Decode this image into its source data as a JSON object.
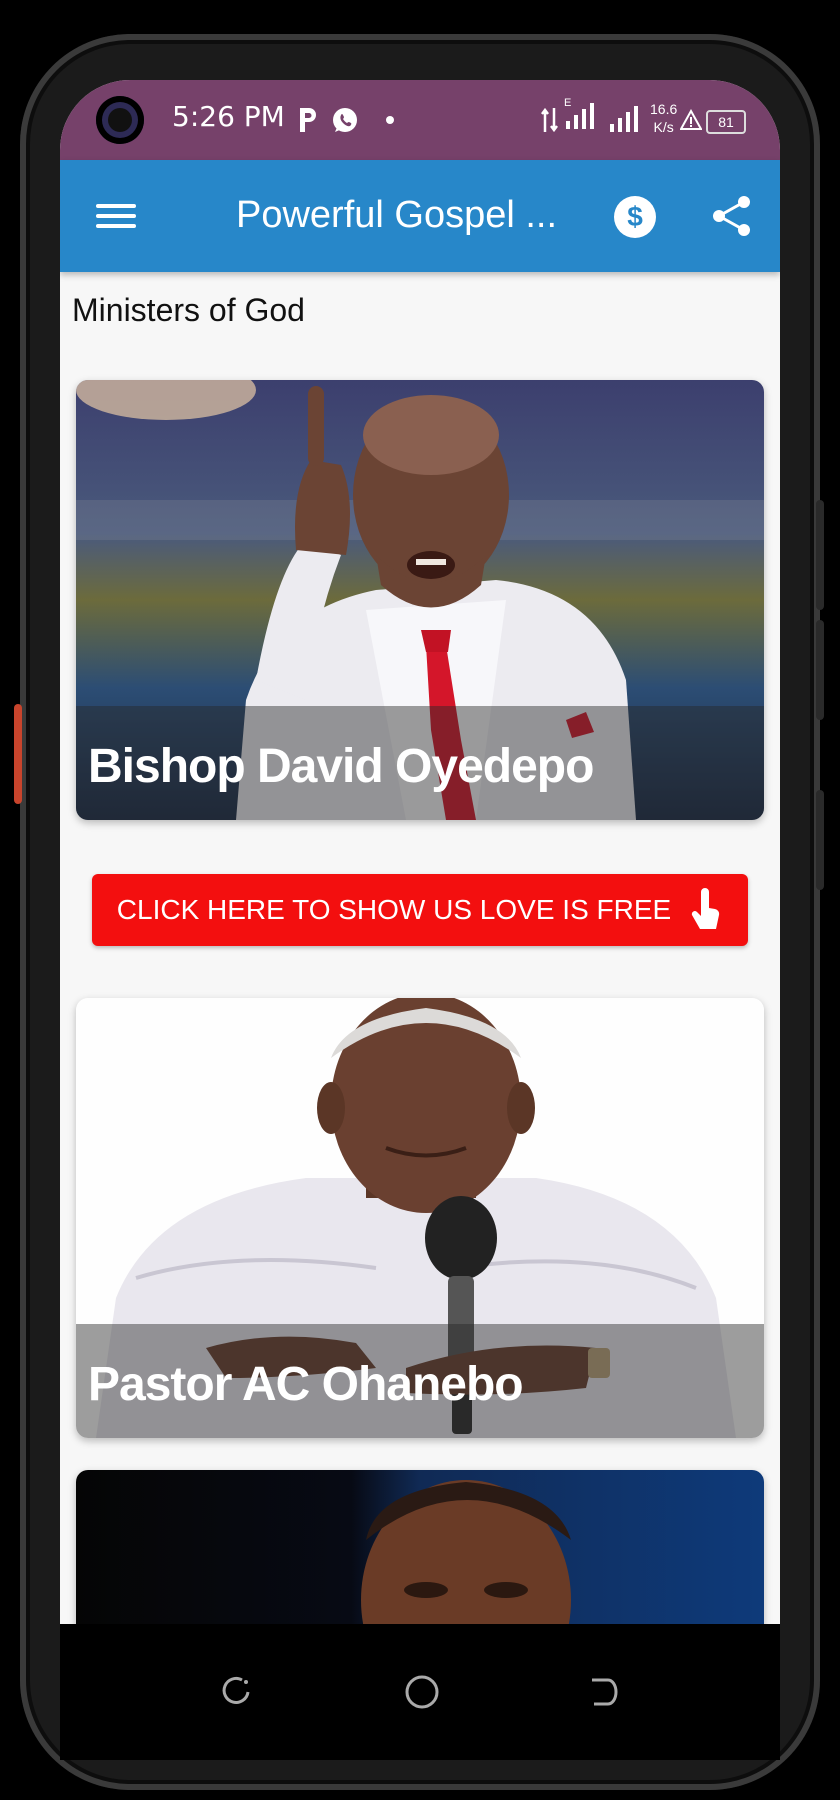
{
  "status_bar": {
    "time": "5:26 PM",
    "network_speed_value": "16.6",
    "network_speed_unit": "K/s",
    "network_type": "E",
    "battery_level": "81",
    "background_color": "#76416a"
  },
  "app_bar": {
    "title": "Powerful Gospel ...",
    "background_color": "#2787c9",
    "menu_icon": "hamburger-menu-icon",
    "donate_icon": "dollar-coin-icon",
    "share_icon": "share-icon"
  },
  "section": {
    "title": "Ministers of God"
  },
  "ministers": [
    {
      "name": "Bishop David Oyedepo"
    },
    {
      "name": "Pastor AC Ohanebo"
    },
    {
      "name": ""
    }
  ],
  "promo_button": {
    "label": "CLICK HERE TO SHOW US LOVE IS FREE",
    "icon": "tap-hand-icon",
    "color": "#f30f0f"
  },
  "nav_bar": {
    "recents_icon": "recents-icon",
    "home_icon": "home-circle-icon",
    "back_icon": "back-icon"
  }
}
